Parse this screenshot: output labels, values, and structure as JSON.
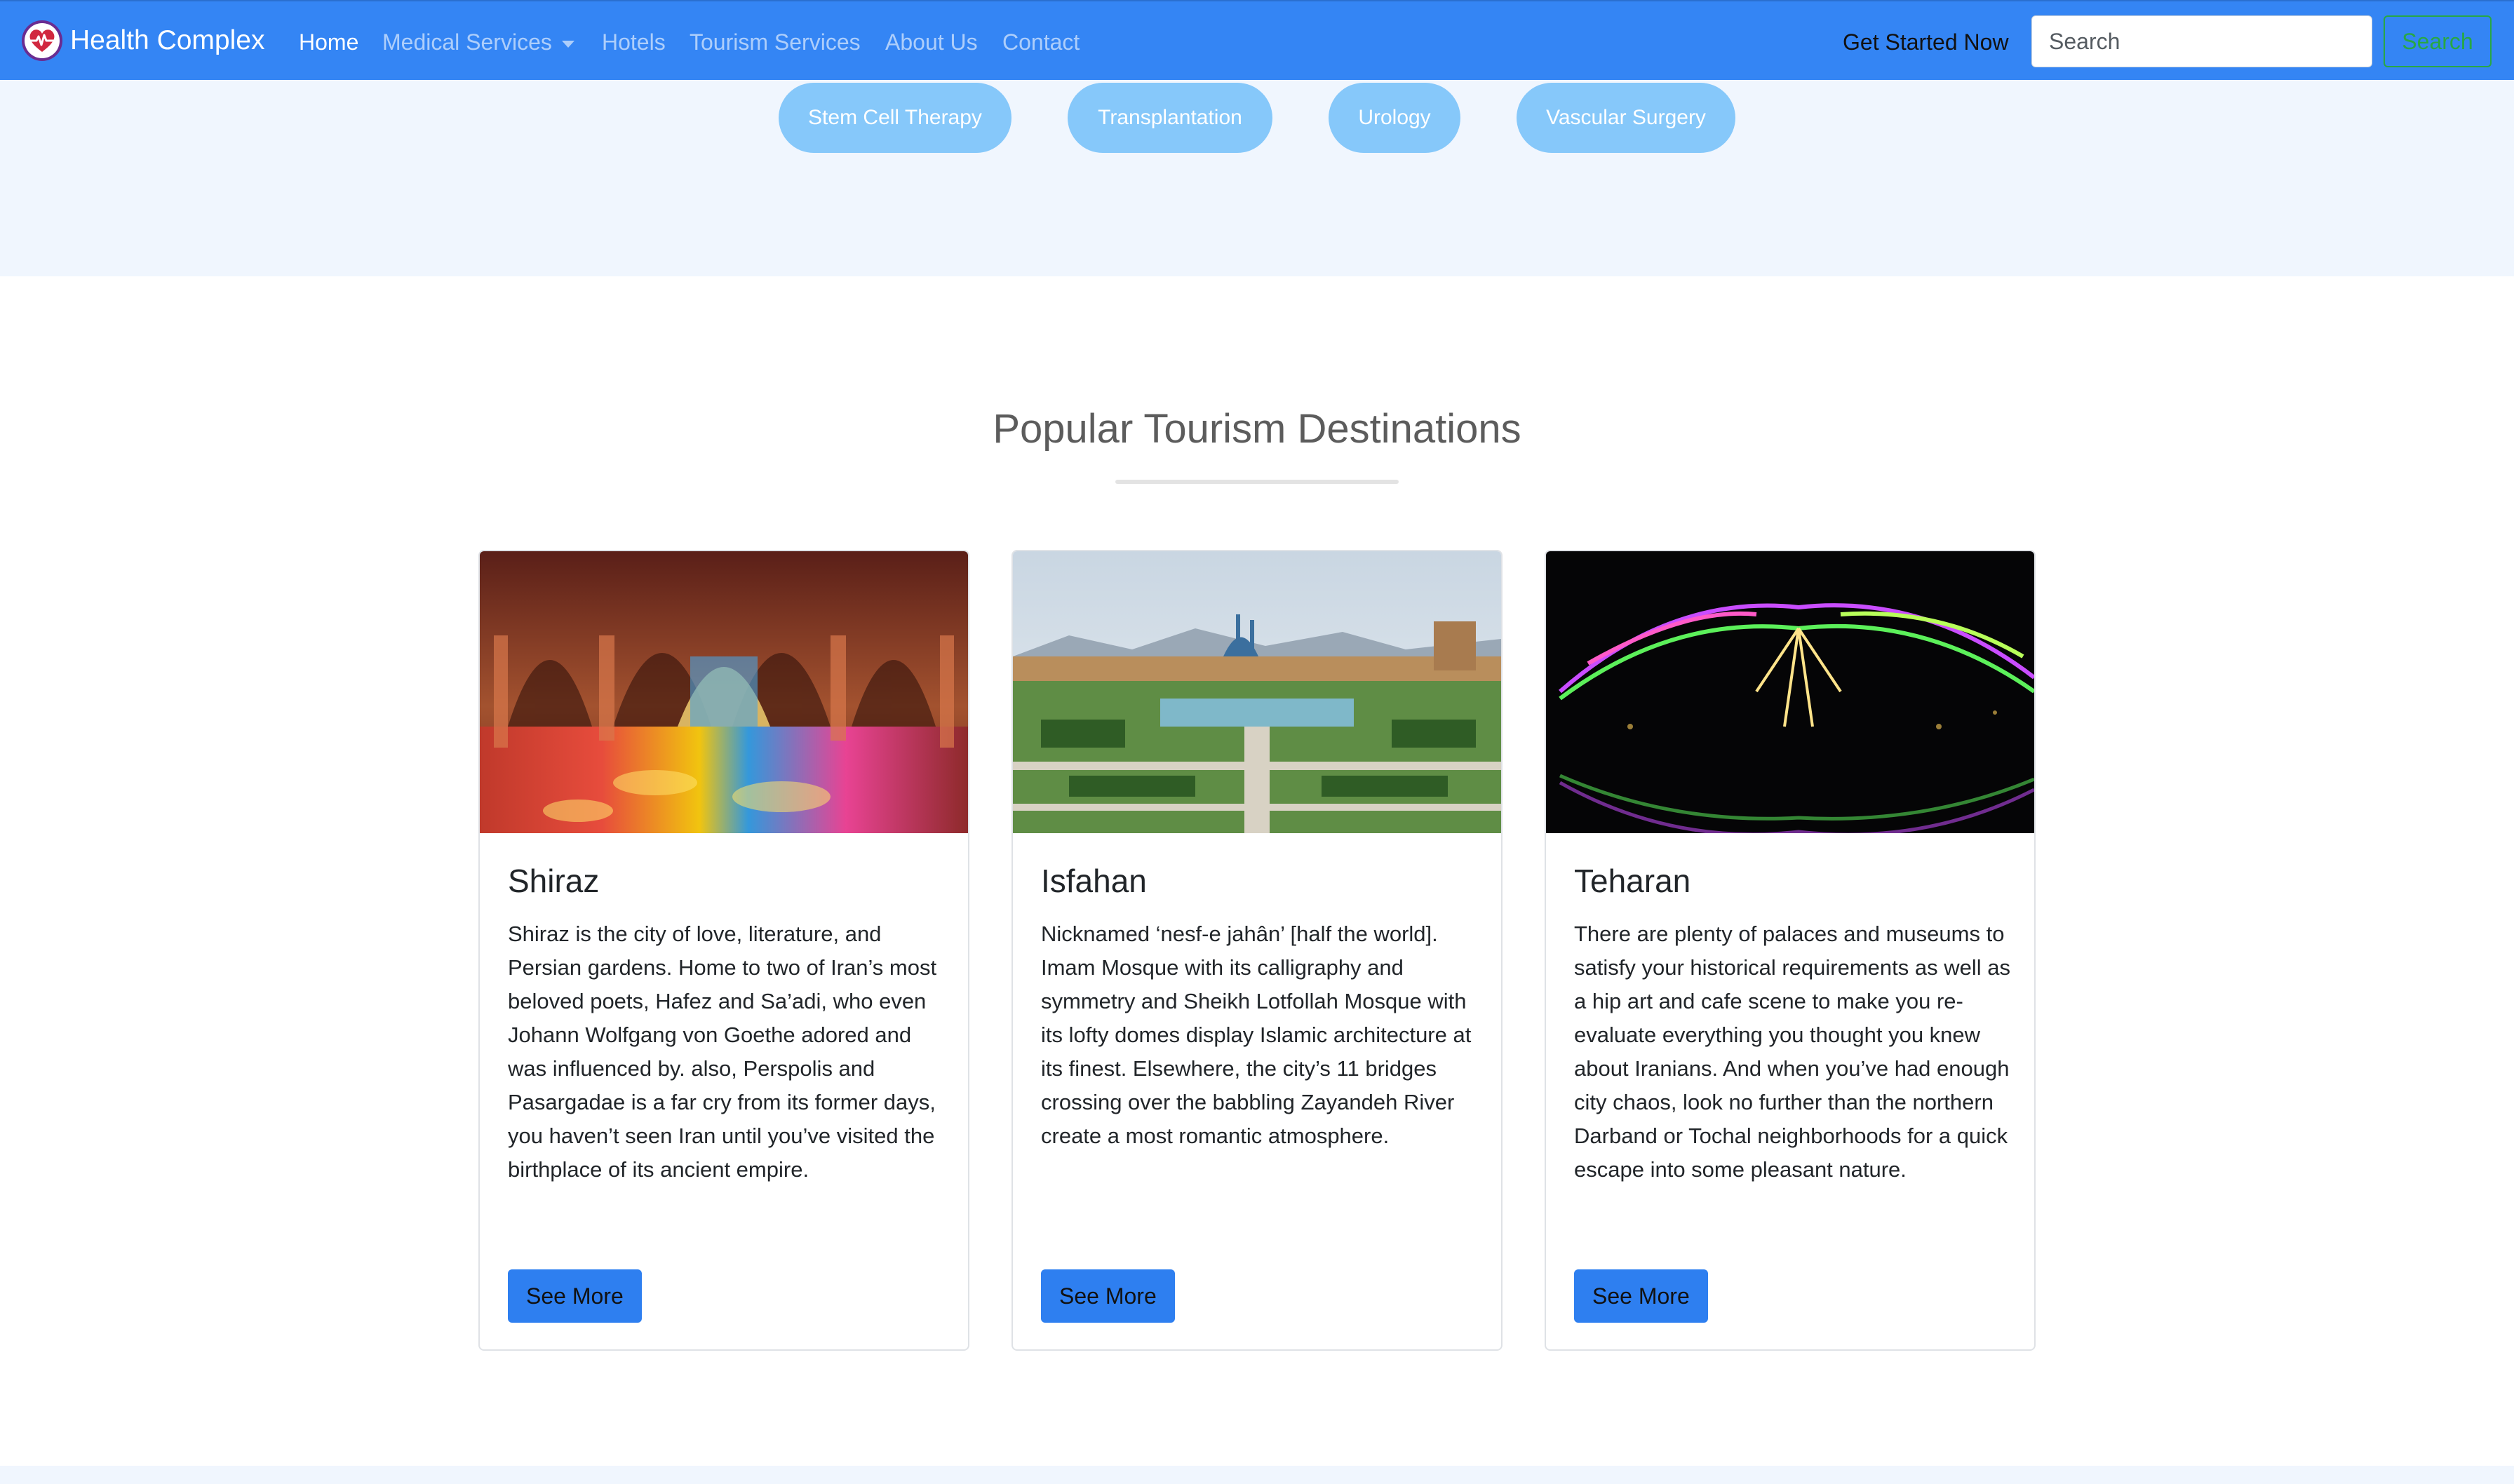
{
  "navbar": {
    "brand": "Health Complex",
    "links": [
      {
        "label": "Home"
      },
      {
        "label": "Medical Services"
      },
      {
        "label": "Hotels"
      },
      {
        "label": "Tourism Services"
      },
      {
        "label": "About Us"
      },
      {
        "label": "Contact"
      }
    ],
    "get_started": "Get Started Now",
    "search_placeholder": "Search",
    "search_button": "Search"
  },
  "services": [
    {
      "label": "Stem Cell Therapy"
    },
    {
      "label": "Transplantation"
    },
    {
      "label": "Urology"
    },
    {
      "label": "Vascular Surgery"
    }
  ],
  "destinations": {
    "title": "Popular Tourism Destinations",
    "cards": [
      {
        "title": "Shiraz",
        "text": "Shiraz is the city of love, literature, and Persian gardens. Home to two of Iran’s most beloved poets, Hafez and Sa’adi, who even Johann Wolfgang von Goethe adored and was influenced by. also, Perspolis and Pasargadae is a far cry from its former days, you haven’t seen Iran until you’ve visited the birthplace of its ancient empire.",
        "button": "See More"
      },
      {
        "title": "Isfahan",
        "text": "Nicknamed ‘nesf-e jahân’ [half the world]. Imam Mosque with its calligraphy and symmetry and Sheikh Lotfollah Mosque with its lofty domes display Islamic architecture at its finest. Elsewhere, the city’s 11 bridges crossing over the babbling Zayandeh River create a most romantic atmosphere.",
        "button": "See More"
      },
      {
        "title": "Teharan",
        "text": "There are plenty of palaces and museums to satisfy your historical requirements as well as a hip art and cafe scene to make you re-evaluate everything you thought you knew about Iranians. And when you’ve had enough city chaos, look no further than the northern Darband or Tochal neighborhoods for a quick escape into some pleasant nature.",
        "button": "See More"
      }
    ]
  },
  "colors": {
    "navbar": "#3485f4",
    "pill": "#86c8fa",
    "button": "#2e7ff0",
    "search_outline": "#28a745",
    "strip": "#f0f6fe"
  }
}
